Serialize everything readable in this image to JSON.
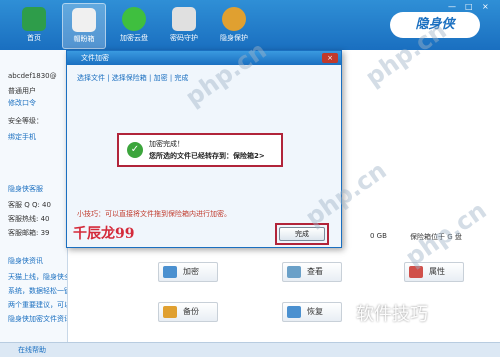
{
  "topbar": {
    "nav": [
      {
        "label": "首页",
        "color": "#2e9d4a"
      },
      {
        "label": "帽盼箱",
        "color": "#f0f0f0"
      },
      {
        "label": "加密云盘",
        "color": "#3fbf3f"
      },
      {
        "label": "密码守护",
        "color": "#e0e0e0"
      },
      {
        "label": "隐身保护",
        "color": "#e0a030"
      }
    ],
    "brand": "隐身侠",
    "controls": [
      "—",
      "□",
      "×"
    ]
  },
  "sidebar": {
    "username": "abcdef1830@",
    "user_type": "普通用户",
    "upgrade": "修改口令",
    "security_label": "安全等级：",
    "bind_phone": "绑定手机",
    "support_title": "隐身侠客服",
    "support_qq": "客服 Q Q: 40",
    "support_hotline": "客服热线: 40",
    "support_email": "客服邮箱: 39",
    "news_title": "隐身侠资讯",
    "news": [
      "天猫上线，隐身侠全场包邮！",
      "系统，数据轻松一键备份！",
      "两个重要建议，可以防备万一",
      "隐身侠加密文件资讯特价！"
    ]
  },
  "main": {
    "storage_text": "0 GB",
    "storage_right": "保险箱位于 G 盘",
    "actions": [
      {
        "label": "加密",
        "color": "#4a90d0"
      },
      {
        "label": "查看",
        "color": "#6aa0c8"
      },
      {
        "label": "属性",
        "color": "#d0504a"
      },
      {
        "label": "备份",
        "color": "#e0a030"
      },
      {
        "label": "恢复",
        "color": "#4a90d0"
      }
    ]
  },
  "dialog": {
    "title": "文件加密",
    "close": "×",
    "steps": "选择文件 | 选择保险箱 | 加密 | 完成",
    "done_title": "加密完成！",
    "done_detail": "您所选的文件已经转存到：保险箱2>",
    "tip": "小技巧：可以直接将文件拖到保险箱内进行加密。",
    "signature": "千辰龙99",
    "ok_button": "完成"
  },
  "statusbar": {
    "text": "在线帮助"
  },
  "watermarks": [
    "php.cn",
    "php.cn",
    "php.cn",
    "php.cn"
  ],
  "corner_mark": "软件技巧",
  "colors": {
    "accent": "#1a6fc0",
    "highlight": "#b1243a"
  }
}
